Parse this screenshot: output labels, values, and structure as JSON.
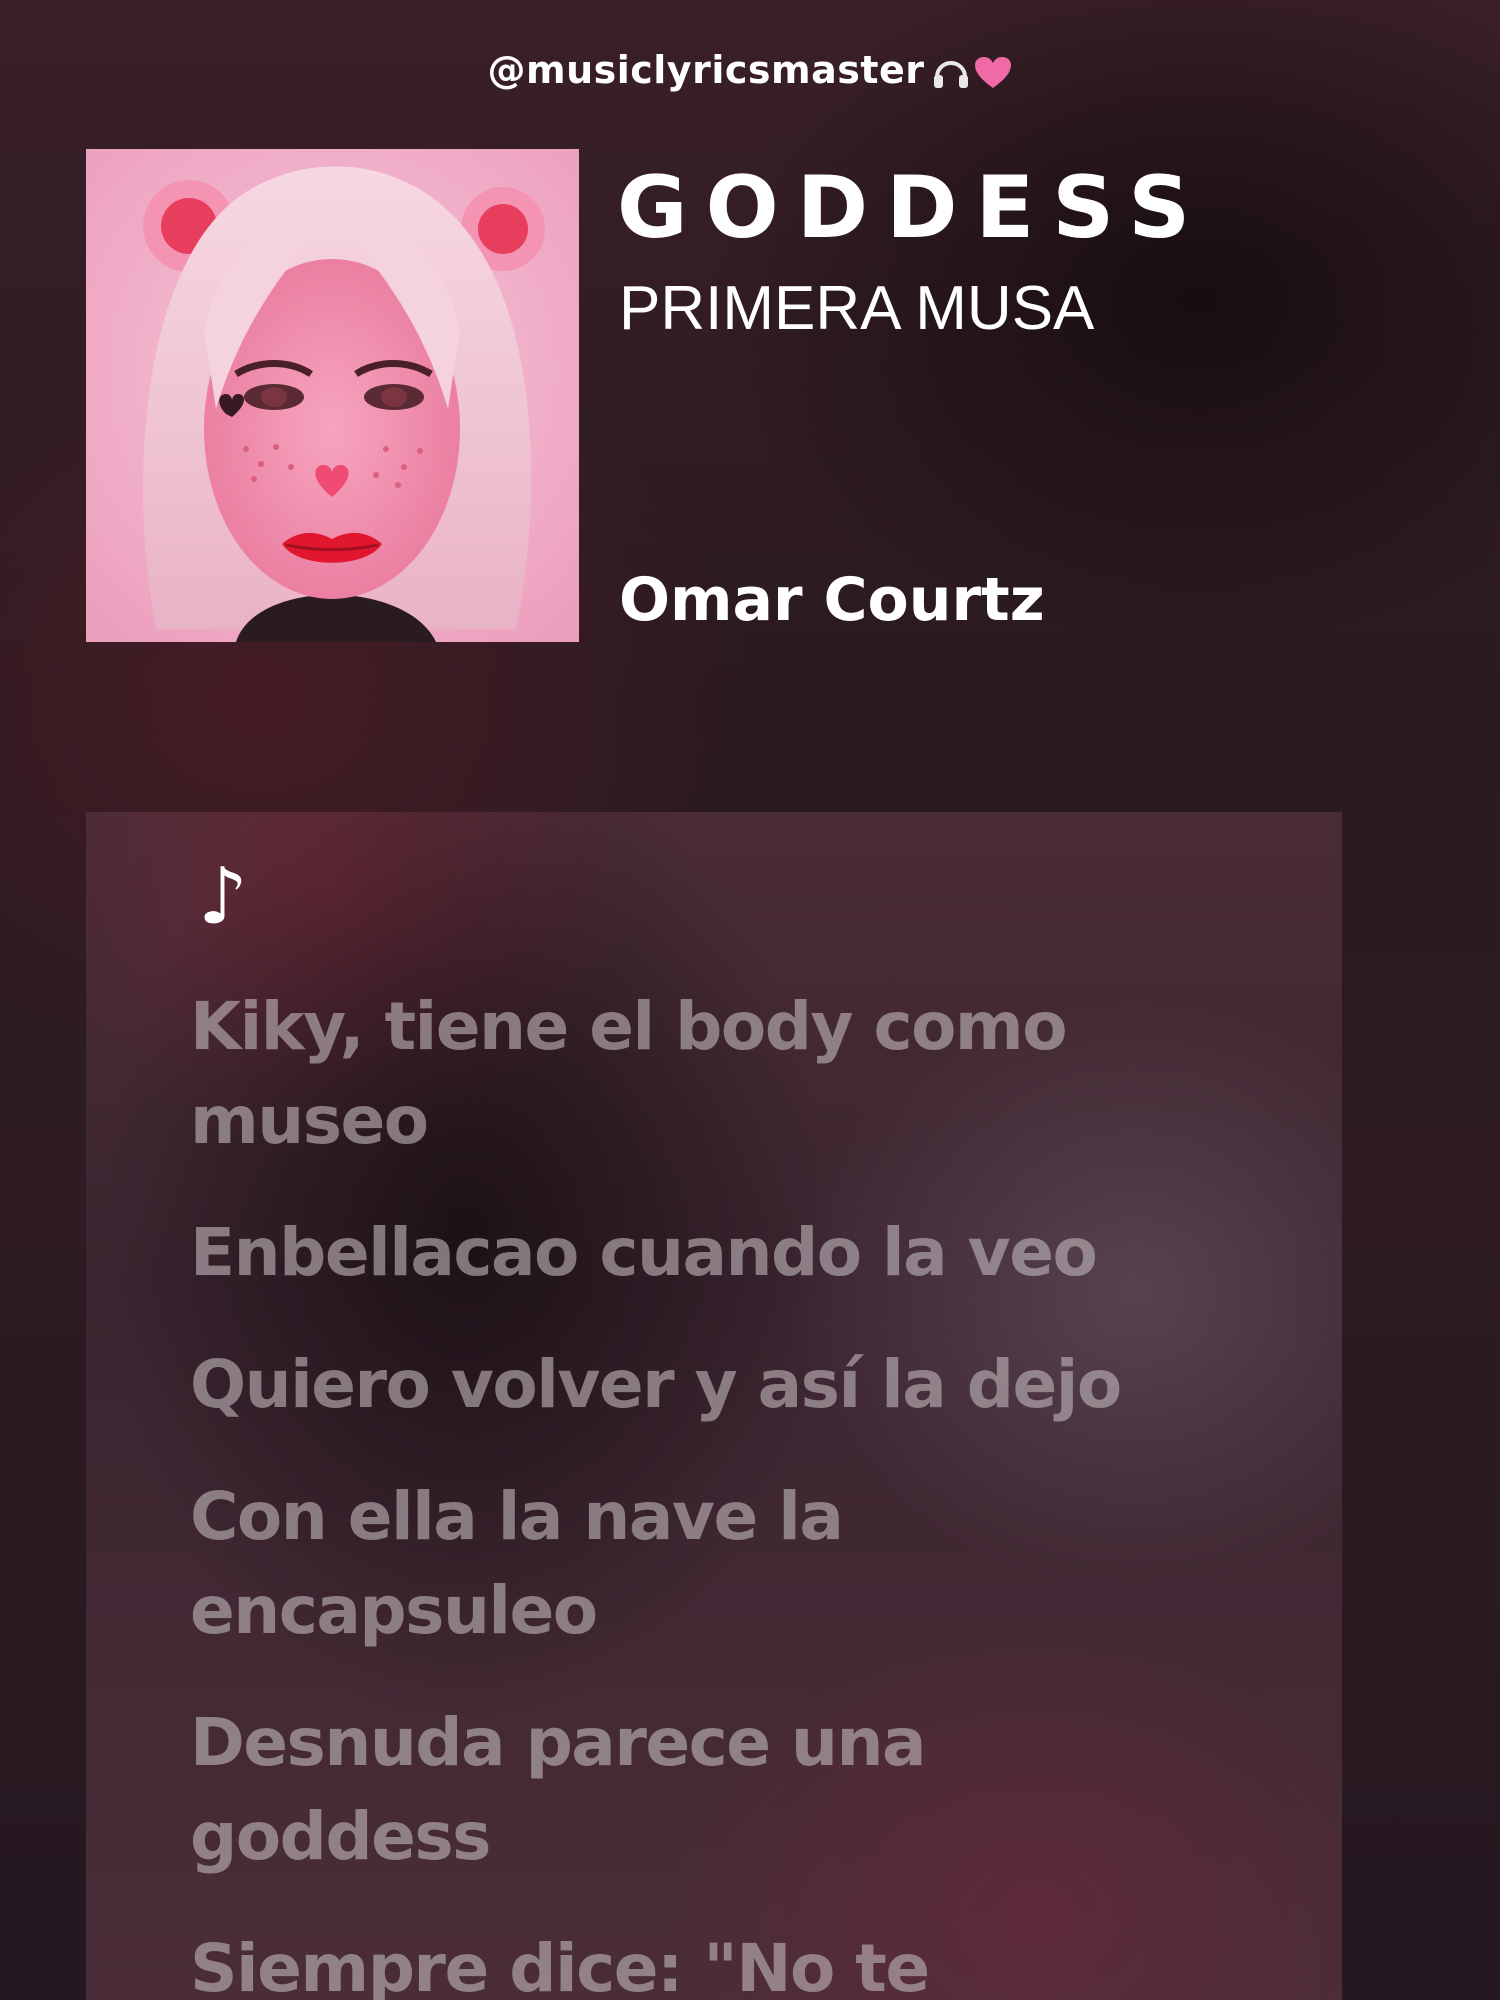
{
  "header": {
    "handle": "@musiclyricsmaster",
    "handle_icons": [
      "headphones-icon",
      "pink-heart-icon"
    ]
  },
  "song": {
    "title": "GODDESS",
    "album": "PRIMERA MUSA",
    "artist": "Omar Courtz",
    "cover_art": "pink-cartoon-bear-ears-portrait"
  },
  "lyrics": {
    "note_icon": "♪",
    "lines": [
      "Kiky, tiene el body como museo",
      "Enbellacao cuando la veo",
      "Quiero volver y así la dejo",
      "Con ella la nave la encapsuleo",
      "Desnuda parece una goddess",
      "Siempre dice: \"No te"
    ]
  },
  "colors": {
    "background": "#2a1a20",
    "lyric_text": "#bfb4ba",
    "accent_pink": "#f06aa8"
  }
}
